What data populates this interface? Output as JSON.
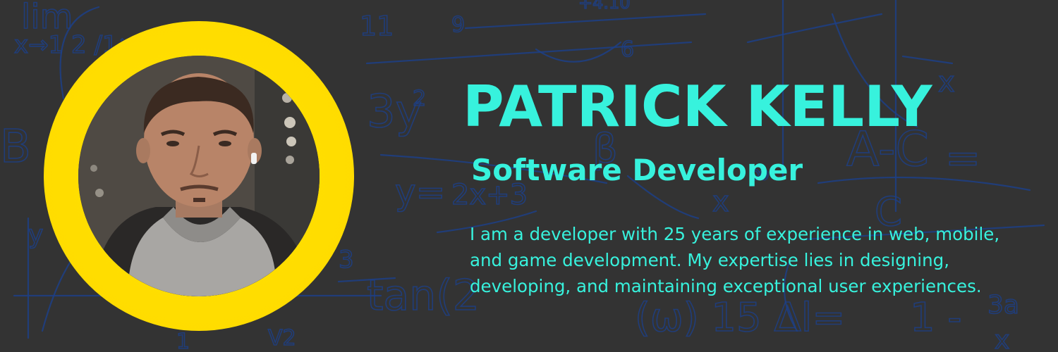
{
  "profile": {
    "name": "PATRICK KELLY",
    "title": "Software Developer",
    "bio": "I am a developer with 25 years of experience in web, mobile, and game development. My expertise lies in designing, developing, and maintaining exceptional user experiences."
  },
  "colors": {
    "background": "#333333",
    "accent_text": "#37f2dd",
    "glow": "#ffdd00",
    "math_scribbles": "#1d3f86"
  }
}
